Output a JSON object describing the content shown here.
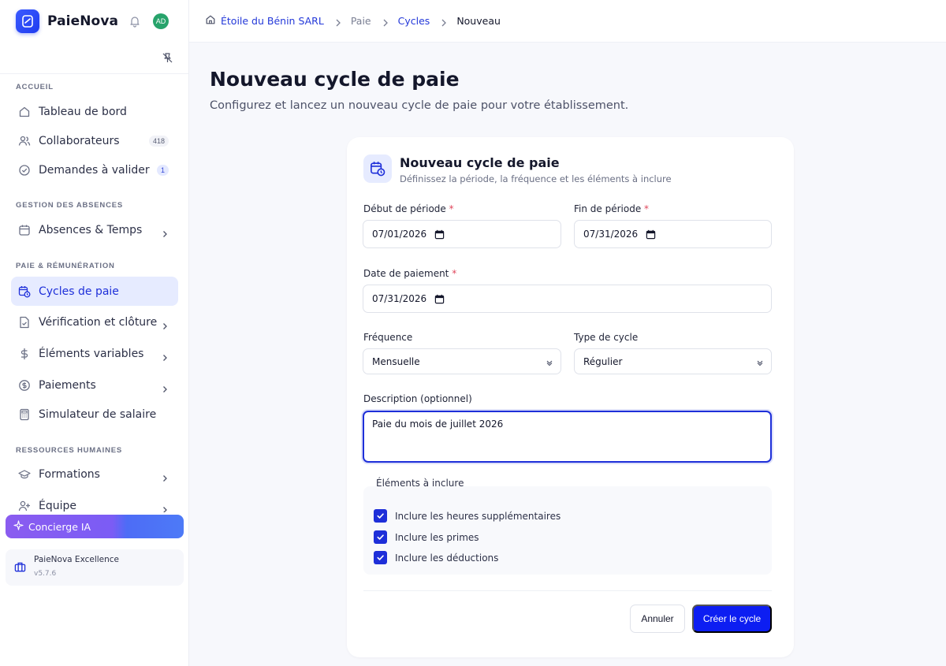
{
  "app": {
    "name": "PaieNova",
    "avatar_initials": "AD"
  },
  "breadcrumb": {
    "company": "Étoile du Bénin SARL",
    "section": "Paie",
    "subsection": "Cycles",
    "current": "Nouveau"
  },
  "sidebar": {
    "sections": [
      {
        "label": "ACCUEIL"
      },
      {
        "label": "GESTION DES ABSENCES"
      },
      {
        "label": "PAIE & RÉMUNÉRATION"
      },
      {
        "label": "RESSOURCES HUMAINES"
      }
    ],
    "items": [
      {
        "label": "Tableau de bord",
        "icon": "home-icon"
      },
      {
        "label": "Collaborateurs",
        "icon": "users-icon",
        "badge": "418"
      },
      {
        "label": "Demandes à valider",
        "icon": "check-circle-icon",
        "badge": "1"
      },
      {
        "label": "Absences & Temps",
        "icon": "calendar-icon"
      },
      {
        "label": "Cycles de paie",
        "icon": "calendar-clock-icon",
        "active": true
      },
      {
        "label": "Vérification et clôture",
        "icon": "file-check-icon"
      },
      {
        "label": "Éléments variables",
        "icon": "dollar-icon"
      },
      {
        "label": "Paiements",
        "icon": "coin-icon"
      },
      {
        "label": "Simulateur de salaire",
        "icon": "calculator-icon"
      },
      {
        "label": "Formations",
        "icon": "graduation-cap-icon"
      },
      {
        "label": "Équipe",
        "icon": "user-plus-icon"
      }
    ],
    "concierge_label": "Concierge IA",
    "footer": {
      "name": "PaieNova Excellence",
      "version": "v5.7.6"
    }
  },
  "page": {
    "title": "Nouveau cycle de paie",
    "subtitle": "Configurez et lancez un nouveau cycle de paie pour votre établissement."
  },
  "form": {
    "title": "Nouveau cycle de paie",
    "subtitle": "Définissez la période, la fréquence et les éléments à inclure",
    "start_label": "Début de période",
    "start_value": "07/01/2026",
    "end_label": "Fin de période",
    "end_value": "07/31/2026",
    "payment_label": "Date de paiement",
    "payment_value": "07/31/2026",
    "required_mark": "*",
    "frequency_label": "Fréquence",
    "frequency_value": "Mensuelle",
    "type_label": "Type de cycle",
    "type_value": "Régulier",
    "description_label": "Description (optionnel)",
    "description_value": "Paie du mois de juillet 2026",
    "elements_title": "Éléments à inclure",
    "elements": [
      {
        "label": "Inclure les heures supplémentaires",
        "checked": true
      },
      {
        "label": "Inclure les primes",
        "checked": true
      },
      {
        "label": "Inclure les déductions",
        "checked": true
      }
    ],
    "cancel_label": "Annuler",
    "submit_label": "Créer le cycle"
  },
  "colors": {
    "accent": "#1e2fd9",
    "active_bg": "#e6ebff",
    "primary_button": "#0d1ef2"
  }
}
